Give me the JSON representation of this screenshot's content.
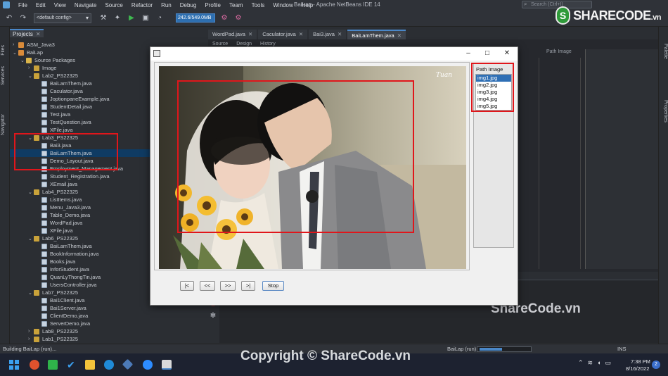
{
  "ide": {
    "menu": [
      "File",
      "Edit",
      "View",
      "Navigate",
      "Source",
      "Refactor",
      "Run",
      "Debug",
      "Profile",
      "Team",
      "Tools",
      "Window",
      "Help"
    ],
    "window_title": "BaiLap - Apache NetBeans IDE 14",
    "search_placeholder": "Search (Ctrl+I)",
    "config": "<default config>",
    "memory": "242.6/549.0MB",
    "projects_tab": "Projects",
    "side_tabs": [
      "Files",
      "Services",
      "Navigator"
    ],
    "right_side_tabs": [
      "Palette",
      "Properties"
    ],
    "editor_tabs": [
      "WordPad.java",
      "Caculator.java",
      "Bai3.java",
      "BaiLamThem.java"
    ],
    "active_editor_tab": "BaiLamThem.java",
    "editor_subtabs": [
      "Source",
      "Design",
      "History"
    ],
    "design_column_header": "Path Image",
    "tree": [
      {
        "depth": 0,
        "caret": ">",
        "icon": "proj",
        "label": "ASM_Java3"
      },
      {
        "depth": 0,
        "caret": "v",
        "icon": "proj",
        "label": "BaiLap"
      },
      {
        "depth": 1,
        "caret": "v",
        "icon": "src",
        "label": "Source Packages"
      },
      {
        "depth": 2,
        "caret": ">",
        "icon": "pkg",
        "label": "Image"
      },
      {
        "depth": 2,
        "caret": "v",
        "icon": "pkg",
        "label": "Lab2_PS22325"
      },
      {
        "depth": 3,
        "caret": "",
        "icon": "java",
        "label": "BaiLamThem.java"
      },
      {
        "depth": 3,
        "caret": "",
        "icon": "java",
        "label": "Caculator.java"
      },
      {
        "depth": 3,
        "caret": "",
        "icon": "java",
        "label": "JoptionpaneExample.java"
      },
      {
        "depth": 3,
        "caret": "",
        "icon": "java",
        "label": "StudentDetail.java"
      },
      {
        "depth": 3,
        "caret": "",
        "icon": "java",
        "label": "Test.java"
      },
      {
        "depth": 3,
        "caret": "",
        "icon": "java",
        "label": "TestQuestion.java"
      },
      {
        "depth": 3,
        "caret": "",
        "icon": "java",
        "label": "XFile.java"
      },
      {
        "depth": 2,
        "caret": "v",
        "icon": "pkg",
        "label": "Lab3_PS22325"
      },
      {
        "depth": 3,
        "caret": "",
        "icon": "java",
        "label": "Bai3.java"
      },
      {
        "depth": 3,
        "caret": "",
        "icon": "java",
        "label": "BaiLamThem.java",
        "selected": true
      },
      {
        "depth": 3,
        "caret": "",
        "icon": "java",
        "label": "Demo_Layout.java"
      },
      {
        "depth": 3,
        "caret": "",
        "icon": "java",
        "label": "Employment_Management.java"
      },
      {
        "depth": 3,
        "caret": "",
        "icon": "java",
        "label": "Student_Registration.java"
      },
      {
        "depth": 3,
        "caret": "",
        "icon": "java",
        "label": "XEmail.java"
      },
      {
        "depth": 2,
        "caret": "v",
        "icon": "pkg",
        "label": "Lab4_PS22325"
      },
      {
        "depth": 3,
        "caret": "",
        "icon": "java",
        "label": "ListItems.java"
      },
      {
        "depth": 3,
        "caret": "",
        "icon": "java",
        "label": "Menu_Java3.java"
      },
      {
        "depth": 3,
        "caret": "",
        "icon": "java",
        "label": "Table_Demo.java"
      },
      {
        "depth": 3,
        "caret": "",
        "icon": "java",
        "label": "WordPad.java"
      },
      {
        "depth": 3,
        "caret": "",
        "icon": "java",
        "label": "XFile.java"
      },
      {
        "depth": 2,
        "caret": "v",
        "icon": "pkg",
        "label": "Lab6_PS22325"
      },
      {
        "depth": 3,
        "caret": "",
        "icon": "java",
        "label": "BaiLamThem.java"
      },
      {
        "depth": 3,
        "caret": "",
        "icon": "java",
        "label": "BookInformation.java"
      },
      {
        "depth": 3,
        "caret": "",
        "icon": "java",
        "label": "Books.java"
      },
      {
        "depth": 3,
        "caret": "",
        "icon": "java",
        "label": "InforStudent.java"
      },
      {
        "depth": 3,
        "caret": "",
        "icon": "java",
        "label": "QuanLyThongTin.java"
      },
      {
        "depth": 3,
        "caret": "",
        "icon": "java",
        "label": "UsersController.java"
      },
      {
        "depth": 2,
        "caret": "v",
        "icon": "pkg",
        "label": "Lab7_PS22325"
      },
      {
        "depth": 3,
        "caret": "",
        "icon": "java",
        "label": "Bai1Client.java"
      },
      {
        "depth": 3,
        "caret": "",
        "icon": "java",
        "label": "Bai1Server.java"
      },
      {
        "depth": 3,
        "caret": "",
        "icon": "java",
        "label": "ClientDemo.java"
      },
      {
        "depth": 3,
        "caret": "",
        "icon": "java",
        "label": "ServerDemo.java"
      },
      {
        "depth": 2,
        "caret": ">",
        "icon": "pkg",
        "label": "Lab8_PS22325"
      },
      {
        "depth": 2,
        "caret": ">",
        "icon": "pkg",
        "label": "Lab1_PS22325"
      }
    ],
    "status_build": "Building BaiLap (run)...",
    "status_run": "BaiLap (run)",
    "status_progress": 0.45,
    "status_mode": "INS"
  },
  "app": {
    "path_header": "Path Image",
    "images": [
      "img1.jpg",
      "img2.jpg",
      "img3.jpg",
      "img4.jpg",
      "img5.jpg"
    ],
    "selected_index": 0,
    "photo_signature": "Tuan",
    "buttons": {
      "first": "|<",
      "prev": "<<",
      "next": ">>",
      "last": ">|",
      "stop": "Stop"
    }
  },
  "taskbar": {
    "time": "7:38 PM",
    "date": "8/16/2022",
    "notifications": "2"
  },
  "watermark": {
    "logo_text": "SHARECODE",
    "logo_suffix": ".vn",
    "mid_text": "ShareCode.vn",
    "copyright": "Copyright © ShareCode.vn"
  },
  "colors": {
    "highlight": "#e0161b",
    "selection": "#2f6fb5",
    "tree_selection": "#0f3b63"
  }
}
